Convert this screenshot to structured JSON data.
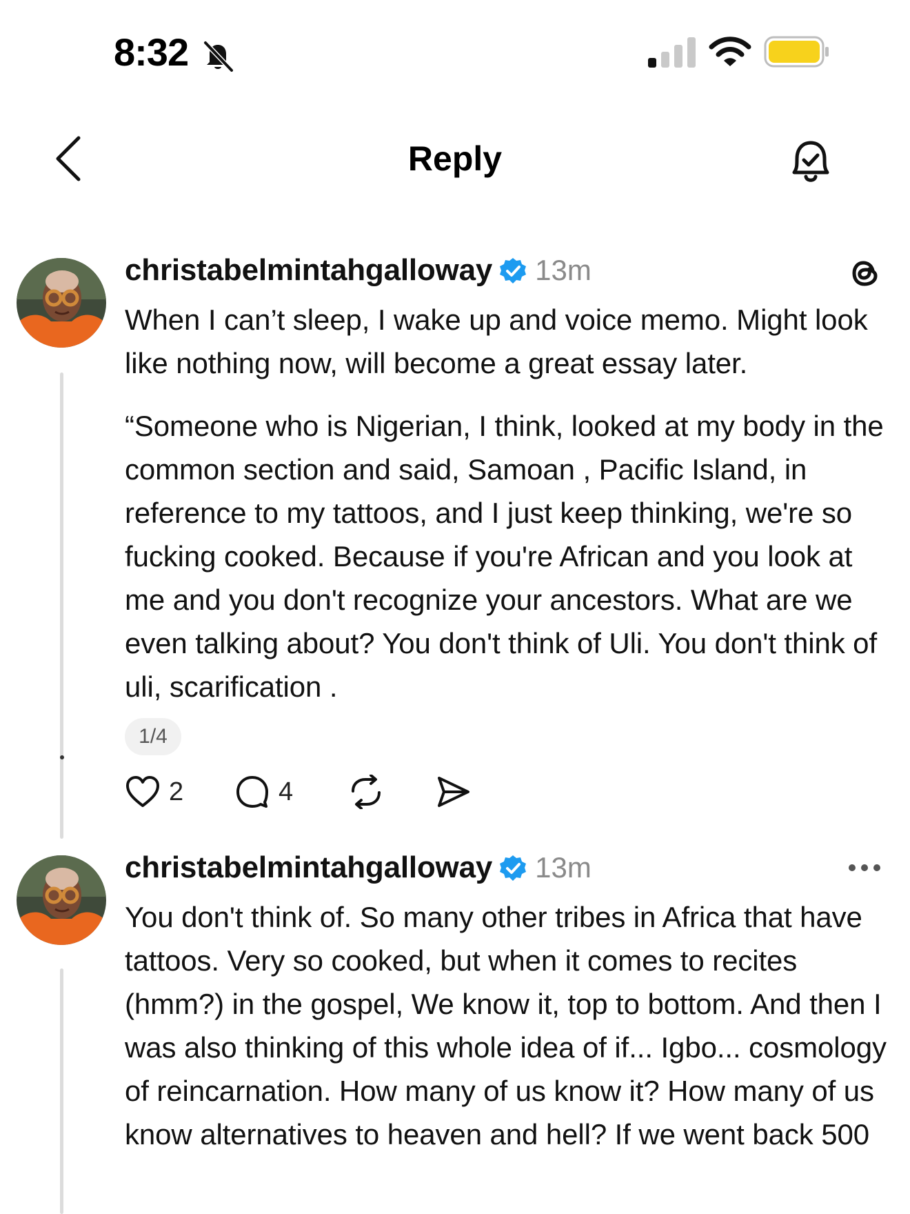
{
  "status_bar": {
    "time": "8:32",
    "icons": [
      "bell-off-icon",
      "signal-icon",
      "wifi-icon",
      "battery-icon"
    ],
    "battery_color": "#f7d21c"
  },
  "header": {
    "title": "Reply",
    "back_icon": "chevron-left-icon",
    "right_icon": "bell-check-icon"
  },
  "posts": [
    {
      "username": "christabelmintahgalloway",
      "verified": true,
      "time": "13m",
      "corner_icon": "threads-logo-icon",
      "paragraphs": [
        "When I can’t sleep, I wake up and voice memo. Might look like nothing now, will become a great essay later.",
        "“Someone who is Nigerian, I think, looked at my body in the common section and said, Samoan , Pacific Island, in reference to my tattoos, and I just keep thinking, we're so fucking cooked. Because if you're African and you look at me and you don't recognize your ancestors. What are we even talking about? You don't think of Uli. You don't think of uli, scarification ."
      ],
      "page_indicator": "1/4",
      "actions": {
        "likes": "2",
        "replies": "4"
      }
    },
    {
      "username": "christabelmintahgalloway",
      "verified": true,
      "time": "13m",
      "corner_icon": "more-icon",
      "paragraphs": [
        "You don't think of. So many other tribes in Africa that have tattoos. Very so cooked, but when it comes to recites (hmm?) in the gospel, We know it, top to bottom. And then I was also thinking of this whole idea of if... Igbo... cosmology of reincarnation. How many of us know it? How many of us know alternatives to heaven and hell? If we went back 500"
      ]
    }
  ],
  "colors": {
    "verified_blue": "#1d9bf0",
    "muted_text": "#8a8a8a",
    "thread_line": "#dcdcdc"
  }
}
